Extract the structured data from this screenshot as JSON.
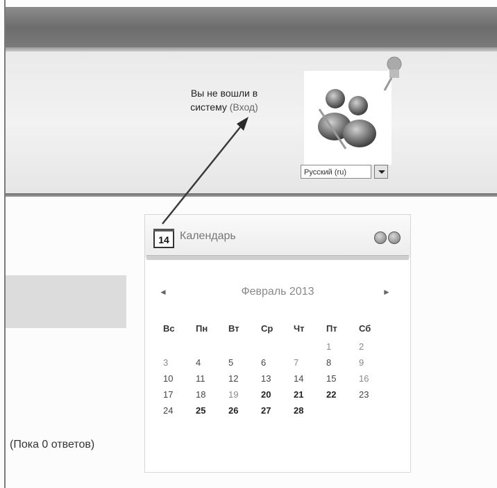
{
  "header": {
    "login_line1": "Вы не вошли в",
    "login_line2": "систему",
    "login_link": "(Вход)",
    "language": "Русский (ru)"
  },
  "main": {
    "replies_text": "(Пока 0 ответов)"
  },
  "calendar": {
    "title": "Календарь",
    "icon_day": "14",
    "month": "Февраль 2013",
    "prev": "◄",
    "next": "►",
    "weekdays": [
      "Вс",
      "Пн",
      "Вт",
      "Ср",
      "Чт",
      "Пт",
      "Сб"
    ],
    "weeks": [
      [
        "",
        "",
        "",
        "",
        "",
        "1",
        "2"
      ],
      [
        "3",
        "4",
        "5",
        "6",
        "7",
        "8",
        "9"
      ],
      [
        "10",
        "11",
        "12",
        "13",
        "14",
        "15",
        "16"
      ],
      [
        "17",
        "18",
        "19",
        "20",
        "21",
        "22",
        "23"
      ],
      [
        "24",
        "25",
        "26",
        "27",
        "28",
        "",
        ""
      ]
    ]
  }
}
